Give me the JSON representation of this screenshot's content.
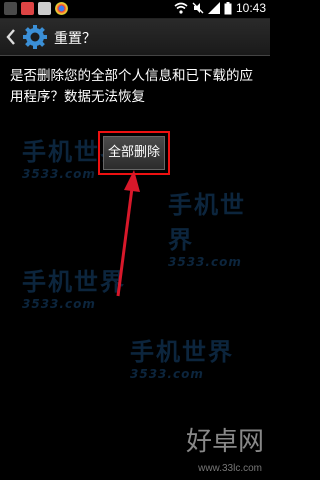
{
  "status_bar": {
    "time": "10:43"
  },
  "action_bar": {
    "title": "重置？"
  },
  "dialog": {
    "message": "是否删除您的全部个人信息和已下载的应用程序？数据无法恢复",
    "button_label": "全部删除"
  },
  "watermark": {
    "text": "手机世界",
    "sub": "3533.com",
    "logo": "好卓网",
    "url": "www.33lc.com"
  },
  "colors": {
    "highlight": "#e11111",
    "arrow": "#d8182a",
    "gear": "#3b8fd6"
  }
}
